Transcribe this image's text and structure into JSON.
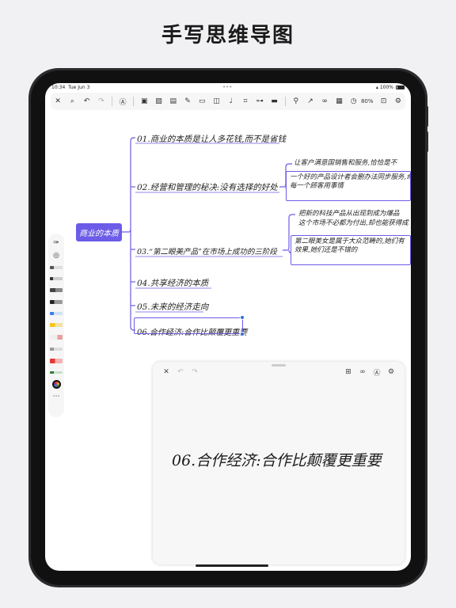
{
  "headline": "手写思维导图",
  "status": {
    "time": "10:34",
    "date": "Tue Jun 3",
    "dots": "•••",
    "battery_label": "100%"
  },
  "toolbar": {
    "left_icons": [
      "close-icon",
      "search-icon",
      "undo-icon",
      "redo-icon"
    ],
    "center_icons": [
      "pen-circle-icon",
      "text-icon",
      "image-icon",
      "note-icon",
      "edit-icon",
      "folder-icon",
      "shape-icon",
      "mic-icon",
      "scan-icon",
      "layout-icon",
      "canvas-icon",
      "pin-icon",
      "arrow-icon",
      "link-icon",
      "grid-icon",
      "clock-icon"
    ],
    "zoom": "80%",
    "right_icons": [
      "lock-icon",
      "gear-icon"
    ]
  },
  "mindmap": {
    "root": "商业的本质",
    "branches": [
      "01.商业的本质是让人多花钱,而不是省钱",
      "02.经营和管理的秘决:没有选择的好处",
      "03.“第二眼美产品”在市场上成功的三阶段",
      "04.共享经济的本质",
      "05.未来的经济走向",
      "06.合作经济:合作比颠覆更重要"
    ],
    "branch2_sub_text": "让客户满意国销售和服务,恰恰是不",
    "branch2_box_text": "一个好的产品设计者会删办法同步服务,命\n每一个顾客用事情",
    "branch3_sub_text": "把新的科技产品从出现到成为爆品",
    "branch3_sub_text2": "这个市场不必都为付出,却也能获得成",
    "branch3_box_text": "第二眼美女是属于大众范畴的,她们有\n效果,她们还是不错的"
  },
  "left_tools": {
    "icons": [
      "palette-brush-icon",
      "target-icon"
    ],
    "pens": [
      {
        "name": "pencil",
        "color": "#555555"
      },
      {
        "name": "fineliner",
        "color": "#333333"
      },
      {
        "name": "fountain-pen",
        "color": "#555555"
      },
      {
        "name": "calligraphy-pen",
        "color": "#333333"
      },
      {
        "name": "blue-pen",
        "color": "#3b7de9"
      },
      {
        "name": "highlighter-yellow",
        "color": "#f5c518"
      },
      {
        "name": "eraser",
        "color": "#e6a0a0"
      },
      {
        "name": "gray-marker",
        "color": "#bbbbbb"
      },
      {
        "name": "red-marker",
        "color": "#e53935"
      },
      {
        "name": "green-pen",
        "color": "#2e7d32"
      }
    ],
    "bottom_icons": [
      "color-wheel-icon",
      "more-icon"
    ]
  },
  "panel": {
    "left_icons": [
      "close-icon",
      "undo-icon",
      "redo-icon"
    ],
    "right_icons": [
      "insert-icon",
      "link-icon",
      "pen-circle-icon",
      "gear-icon"
    ],
    "handwriting": "06.合作经济:合作比颠覆更重要"
  },
  "colors": {
    "accent": "#6c5ce7",
    "selection": "#2f6fde"
  }
}
